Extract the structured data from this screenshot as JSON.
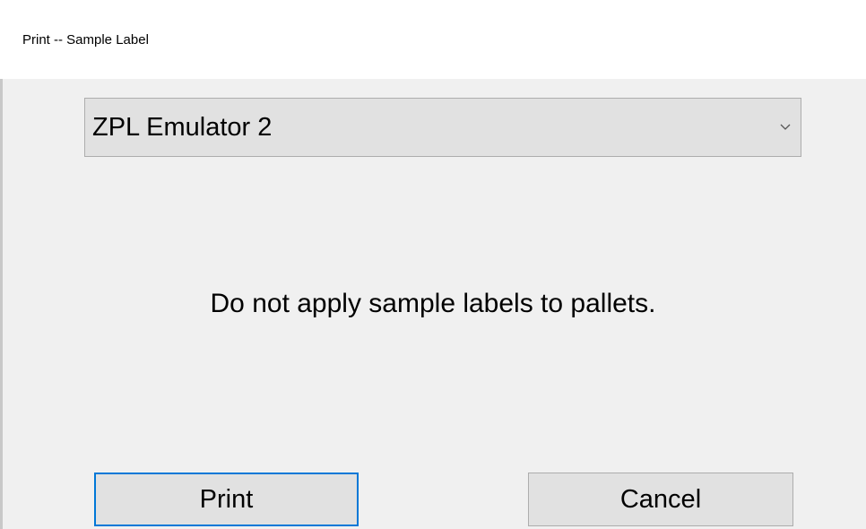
{
  "window": {
    "title": "Print -- Sample Label"
  },
  "printer_select": {
    "selected": "ZPL Emulator 2",
    "arrow_icon": "chevron-down-icon"
  },
  "message": {
    "text": "Do not apply sample labels to pallets."
  },
  "buttons": {
    "print_label": "Print",
    "cancel_label": "Cancel"
  },
  "colors": {
    "background": "#f0f0f0",
    "titlebar": "#ffffff",
    "button_face": "#e1e1e1",
    "button_border": "#adadad",
    "focus_accent": "#0078d7"
  }
}
